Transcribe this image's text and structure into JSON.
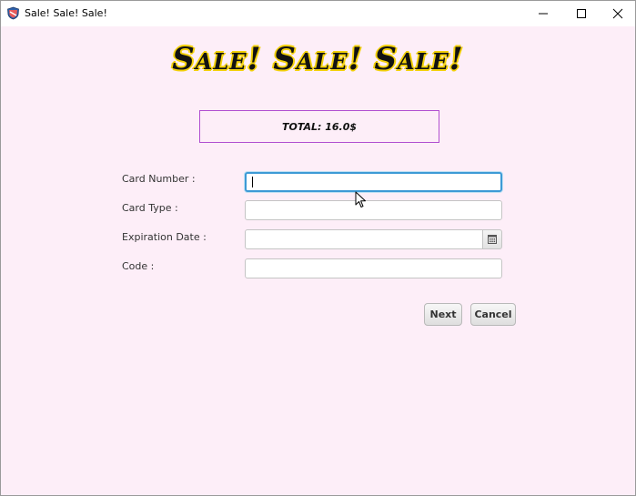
{
  "window": {
    "title": "Sale! Sale! Sale!",
    "icons": {
      "app": "app-icon",
      "minimize": "minimize-icon",
      "maximize": "maximize-icon",
      "close": "close-icon"
    }
  },
  "header": {
    "heading": "Sale! Sale! Sale!"
  },
  "summary": {
    "total": "TOTAL: 16.0$"
  },
  "form": {
    "card_number": {
      "label": "Card Number :",
      "value": ""
    },
    "card_type": {
      "label": "Card Type :",
      "value": ""
    },
    "expiration_date": {
      "label": "Expiration Date :",
      "value": "",
      "icon": "calendar-icon"
    },
    "code": {
      "label": "Code :",
      "value": ""
    }
  },
  "actions": {
    "next": "Next",
    "cancel": "Cancel"
  },
  "colors": {
    "background": "#fdeef8",
    "heading_outline": "#f3d10a",
    "total_border": "#b14fd0",
    "focus": "#3d9ad6"
  }
}
